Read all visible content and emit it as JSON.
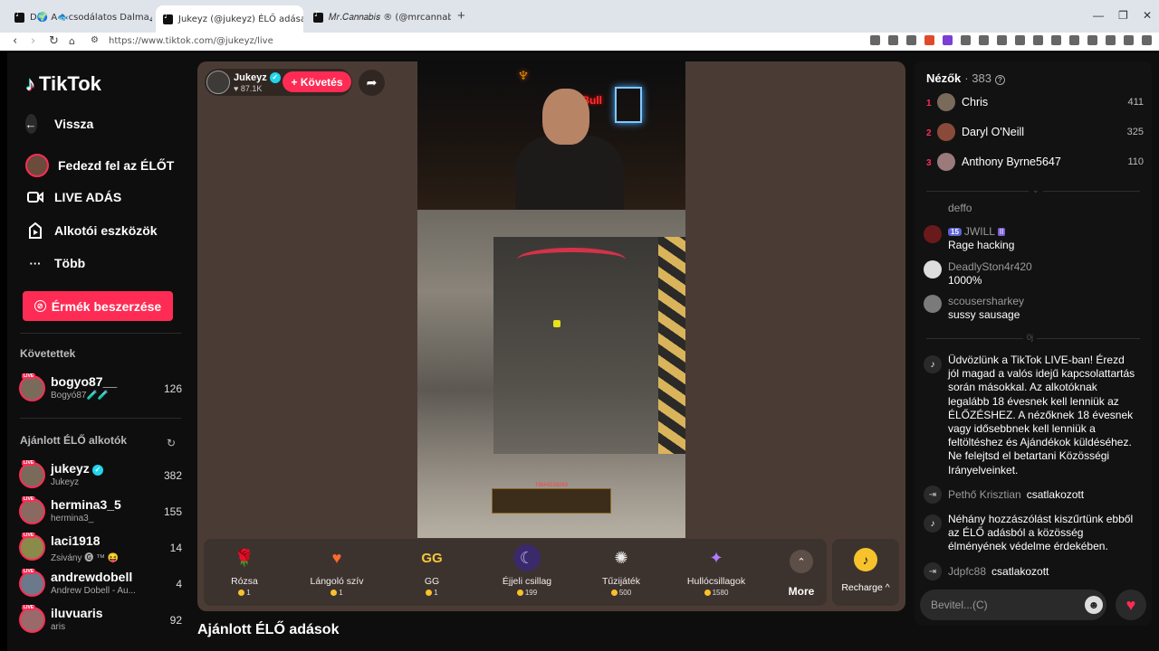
{
  "browser": {
    "tabs": [
      {
        "title": "D🌍 A🐟csodálatos Dalma🏔🐸 (@..."
      },
      {
        "title": "Jukeyz (@jukeyz) ÉLŐ adása"
      },
      {
        "title": "𝑀𝑟.𝐶𝑎𝑛𝑛𝑎𝑏𝑖𝑠 ® (@mrcannabis_)"
      }
    ],
    "url": "https://www.tiktok.com/@jukeyz/live"
  },
  "sidebar": {
    "brand": "TikTok",
    "nav": [
      {
        "label": "Vissza",
        "icon": "back-arrow-icon"
      },
      {
        "label": "Fedezd fel az ÉLŐT",
        "icon": "avatar-icon"
      },
      {
        "label": "LIVE ADÁS",
        "icon": "video-camera-icon"
      },
      {
        "label": "Alkotói eszközök",
        "icon": "creator-tools-icon"
      },
      {
        "label": "Több",
        "icon": "more-dots-icon"
      }
    ],
    "coins_button": "Érmék beszerzése",
    "following_title": "Követettek",
    "following": [
      {
        "name": "bogyo87__",
        "sub": "Bogyó87🧪🧪",
        "count": "126"
      }
    ],
    "recommended_title": "Ajánlott ÉLŐ alkotók",
    "recommended": [
      {
        "name": "jukeyz",
        "sub": "Jukeyz",
        "count": "382"
      },
      {
        "name": "hermina3_5",
        "sub": "hermina3_",
        "count": "155"
      },
      {
        "name": "laci1918",
        "sub": "Zsivány 🅖 ™ 😝",
        "count": "14"
      },
      {
        "name": "andrewdobell",
        "sub": "Andrew Dobell - Au...",
        "count": "4"
      },
      {
        "name": "iluvuaris",
        "sub": "aris",
        "count": "92"
      }
    ]
  },
  "player": {
    "host_name": "Jukeyz",
    "host_likes": "87.1K",
    "follow_label": "+ Követés",
    "hud_text": "Tibi#4226263",
    "gifts": [
      {
        "name": "Rózsa",
        "price": "1",
        "icon": "🌹",
        "color": "#d8324a"
      },
      {
        "name": "Lángoló szív",
        "price": "1",
        "icon": "🧡",
        "color": "#ff6a2a"
      },
      {
        "name": "GG",
        "price": "1",
        "icon": "GG",
        "color": "#f5c63b"
      },
      {
        "name": "Éjjeli csillag",
        "price": "199",
        "icon": "🌙",
        "color": "#6a5ad6"
      },
      {
        "name": "Tűzijáték",
        "price": "500",
        "icon": "✺",
        "color": "#e8e8e8"
      },
      {
        "name": "Hullócsillagok",
        "price": "1580",
        "icon": "✦",
        "color": "#b07cff"
      }
    ],
    "more_label": "More",
    "recharge_label": "Recharge ^",
    "below_heading": "Ajánlott ÉLŐ adások"
  },
  "chat": {
    "viewers_label": "Nézők",
    "viewers_count": "383",
    "top_viewers": [
      {
        "rank": "1",
        "name": "Chris",
        "score": "411"
      },
      {
        "rank": "2",
        "name": "Daryl O'Neill",
        "score": "325"
      },
      {
        "rank": "3",
        "name": "Anthony Byrne5647",
        "score": "110"
      }
    ],
    "messages": [
      {
        "user": "deffo",
        "text": ""
      },
      {
        "user": "JWILL",
        "badge": "15",
        "text": "Rage hacking"
      },
      {
        "user": "DeadlySton4r420",
        "text": "1000%"
      },
      {
        "user": "scousersharkey",
        "text": "sussy sausage"
      }
    ],
    "system_welcome": "Üdvözlünk a TikTok LIVE-ban! Érezd jól magad a valós idejű kapcsolattartás során másokkal. Az alkotóknak legalább 18 évesnek kell lenniük az ÉLŐZÉSHEZ. A nézőknek 18 évesnek vagy idősebbnek kell lenniük a feltöltéshez és Ajándékok küldéséhez. Ne felejtsd el betartani Közösségi Irányelveinket.",
    "join1_name": "Pethő Krisztian",
    "join_label": "csatlakozott",
    "system_filter": "Néhány hozzászólást kiszűrtünk ebből az ÉLŐ adásból a közösség élményének védelme érdekében.",
    "join2_name": "Jdpfc88",
    "input_placeholder": "Bevitel...(C)"
  },
  "colors": {
    "accent": "#fe2c55",
    "player_bg": "#4a3c35",
    "coin": "#f7c22c"
  }
}
